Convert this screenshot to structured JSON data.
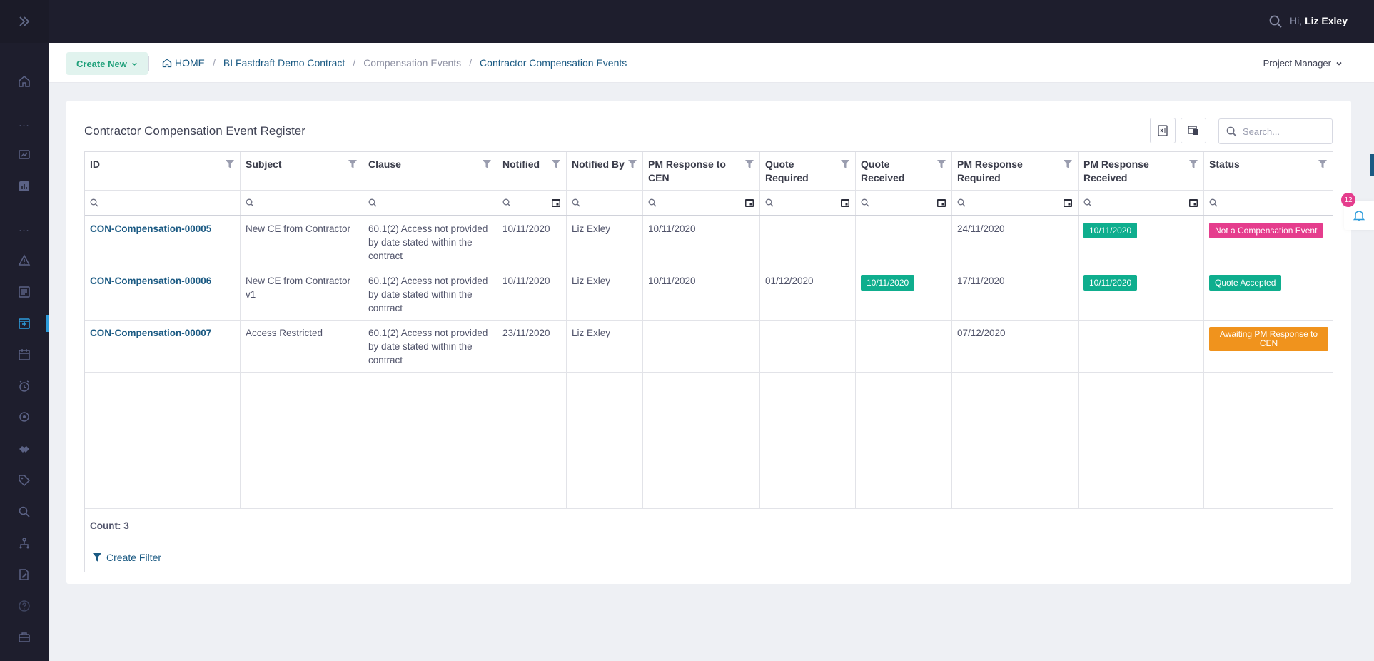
{
  "topbar": {
    "greeting": "Hi,",
    "user_name": "Liz Exley"
  },
  "subheader": {
    "create_new_label": "Create New",
    "breadcrumb": [
      "HOME",
      "BI Fastdraft Demo Contract",
      "Compensation Events",
      "Contractor Compensation Events"
    ],
    "role_label": "Project Manager"
  },
  "register": {
    "title": "Contractor Compensation Event Register",
    "search_placeholder": "Search...",
    "columns": [
      "ID",
      "Subject",
      "Clause",
      "Notified",
      "Notified By",
      "PM Response to CEN",
      "Quote Required",
      "Quote Received",
      "PM Response Required",
      "PM Response Received",
      "Status"
    ],
    "rows": [
      {
        "id": "CON-Compensation-00005",
        "subject": "New CE from Contractor",
        "clause": "60.1(2) Access not provided by date stated within the contract",
        "notified": "10/11/2020",
        "notified_by": "Liz Exley",
        "pm_response_cen": "10/11/2020",
        "quote_required": "",
        "quote_received": "",
        "pm_response_required": "24/11/2020",
        "pm_response_received": "10/11/2020",
        "status": "Not a Compensation Event",
        "status_color": "#e53d8d"
      },
      {
        "id": "CON-Compensation-00006",
        "subject": "New CE from Contractor v1",
        "clause": "60.1(2) Access not provided by date stated within the contract",
        "notified": "10/11/2020",
        "notified_by": "Liz Exley",
        "pm_response_cen": "10/11/2020",
        "quote_required": "01/12/2020",
        "quote_received": "10/11/2020",
        "pm_response_required": "17/11/2020",
        "pm_response_received": "10/11/2020",
        "status": "Quote Accepted",
        "status_color": "#0fae8e"
      },
      {
        "id": "CON-Compensation-00007",
        "subject": "Access Restricted",
        "clause": "60.1(2) Access not provided by date stated within the contract",
        "notified": "23/11/2020",
        "notified_by": "Liz Exley",
        "pm_response_cen": "",
        "quote_required": "",
        "quote_received": "",
        "pm_response_required": "07/12/2020",
        "pm_response_received": "",
        "status": "Awaiting PM Response to CEN",
        "status_color": "#f0931d"
      }
    ],
    "count_label": "Count: 3",
    "create_filter_label": "Create Filter"
  },
  "notifications": {
    "count": "12"
  },
  "colors": {
    "accent": "#1b5a83",
    "success": "#0fae8e",
    "danger": "#e53d8d",
    "warning": "#f0931d",
    "sidebar": "#1e1e2d"
  }
}
